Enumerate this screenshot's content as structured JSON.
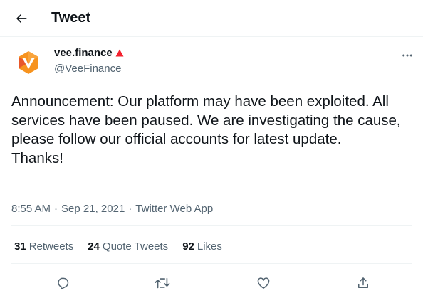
{
  "header": {
    "title": "Tweet",
    "back_icon": "arrow-left-icon"
  },
  "tweet": {
    "author": {
      "display_name": "vee.finance",
      "handle": "@VeeFinance",
      "avatar_icon": "vee-finance-logo",
      "badge_icon": "red-triangle-icon",
      "badge_color": "#f4212e",
      "avatar_colors": [
        "#f7931e",
        "#e8572a"
      ]
    },
    "text": "Announcement: Our platform may have been exploited. All services have been paused. We are investigating the cause, please follow our official accounts for latest update.\nThanks!",
    "time": "8:55 AM",
    "separator": "·",
    "date": "Sep 21, 2021",
    "source": "Twitter Web App"
  },
  "stats": {
    "retweets": {
      "count": "31",
      "label": "Retweets"
    },
    "quote_tweets": {
      "count": "24",
      "label": "Quote Tweets"
    },
    "likes": {
      "count": "92",
      "label": "Likes"
    }
  },
  "actions": [
    "reply-icon",
    "retweet-icon",
    "like-icon",
    "share-icon"
  ],
  "colors": {
    "text_primary": "#0f1419",
    "text_secondary": "#536471",
    "divider": "#eff3f4"
  }
}
